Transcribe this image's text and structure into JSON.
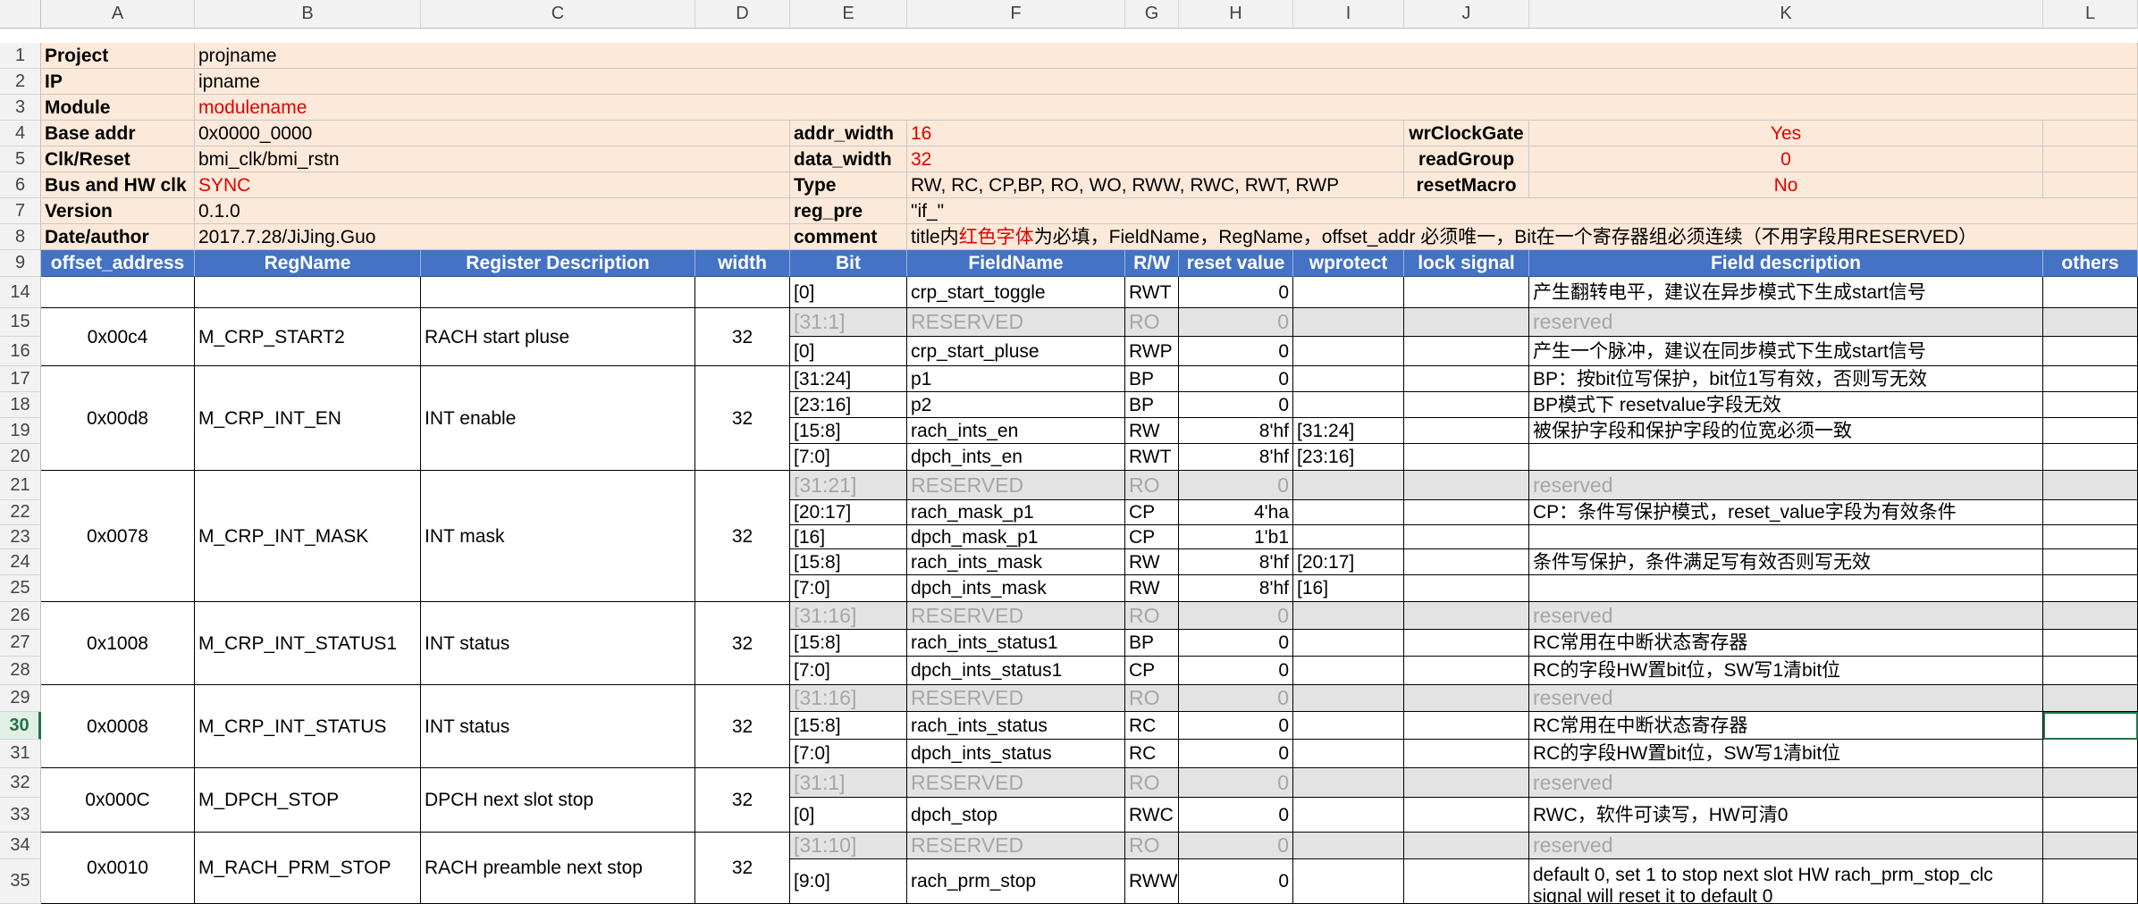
{
  "columns": [
    "A",
    "B",
    "C",
    "D",
    "E",
    "F",
    "G",
    "H",
    "I",
    "J",
    "K",
    "L"
  ],
  "meta": {
    "project_label": "Project",
    "project_value": "projname",
    "ip_label": "IP",
    "ip_value": "ipname",
    "module_label": "Module",
    "module_value": "modulename",
    "base_addr_label": "Base addr",
    "base_addr_value": "0x0000_0000",
    "clk_label": "Clk/Reset",
    "clk_value": "bmi_clk/bmi_rstn",
    "bus_label": "Bus and HW clk",
    "bus_value": "SYNC",
    "version_label": "Version",
    "version_value": "0.1.0",
    "date_label": "Date/author",
    "date_value": "2017.7.28/JiJing.Guo",
    "addr_width_label": "addr_width",
    "addr_width_value": "16",
    "data_width_label": "data_width",
    "data_width_value": "32",
    "type_label": "Type",
    "type_value": "RW, RC, CP,BP, RO, WO, RWW, RWC, RWT, RWP",
    "reg_pre_label": "reg_pre",
    "reg_pre_value": "\"if_\"",
    "comment_label": "comment",
    "comment_prefix": "title内",
    "comment_red": "红色字体",
    "comment_suffix": "为必填，FieldName，RegName，offset_addr 必须唯一，Bit在一个寄存器组必须连续（不用字段用RESERVED）",
    "wrclockgate_label": "wrClockGate",
    "wrclockgate_value": "Yes",
    "readgroup_label": "readGroup",
    "readgroup_value": "0",
    "resetmacro_label": "resetMacro",
    "resetmacro_value": "No"
  },
  "headers": {
    "offset": "offset_address",
    "regname": "RegName",
    "regdesc": "Register Description",
    "width": "width",
    "bit": "Bit",
    "fieldname": "FieldName",
    "rw": "R/W",
    "reset": "reset value",
    "wprotect": "wprotect",
    "lock": "lock signal",
    "fielddesc": "Field description",
    "others": "others"
  },
  "registers": [
    {
      "offset": "",
      "name": "",
      "desc": "",
      "width": ""
    },
    {
      "offset": "0x00c4",
      "name": "M_CRP_START2",
      "desc": "RACH start pluse",
      "width": "32"
    },
    {
      "offset": "0x00d8",
      "name": "M_CRP_INT_EN",
      "desc": "INT enable",
      "width": "32"
    },
    {
      "offset": "0x0078",
      "name": "M_CRP_INT_MASK",
      "desc": "INT mask",
      "width": "32"
    },
    {
      "offset": "0x1008",
      "name": "M_CRP_INT_STATUS1",
      "desc": "INT status",
      "width": "32"
    },
    {
      "offset": "0x0008",
      "name": "M_CRP_INT_STATUS",
      "desc": "INT status",
      "width": "32"
    },
    {
      "offset": "0x000C",
      "name": "M_DPCH_STOP",
      "desc": "DPCH next slot stop",
      "width": "32"
    },
    {
      "offset": "0x0010",
      "name": "M_RACH_PRM_STOP",
      "desc": "RACH preamble next stop",
      "width": "32"
    }
  ],
  "fields": [
    {
      "row": "14",
      "bit": "[0]",
      "name": "crp_start_toggle",
      "rw": "RWT",
      "reset": "0",
      "wprotect": "",
      "desc": "产生翻转电平，建议在异步模式下生成start信号"
    },
    {
      "row": "15",
      "bit": "[31:1]",
      "name": "RESERVED",
      "rw": "RO",
      "reset": "0",
      "wprotect": "",
      "desc": "reserved"
    },
    {
      "row": "16",
      "bit": "[0]",
      "name": "crp_start_pluse",
      "rw": "RWP",
      "reset": "0",
      "wprotect": "",
      "desc": "产生一个脉冲，建议在同步模式下生成start信号"
    },
    {
      "row": "17",
      "bit": "[31:24]",
      "name": "p1",
      "rw": "BP",
      "reset": "0",
      "wprotect": "",
      "desc": "BP：按bit位写保护，bit位1写有效，否则写无效"
    },
    {
      "row": "18",
      "bit": "[23:16]",
      "name": "p2",
      "rw": "BP",
      "reset": "0",
      "wprotect": "",
      "desc": "BP模式下 resetvalue字段无效"
    },
    {
      "row": "19",
      "bit": "[15:8]",
      "name": "rach_ints_en",
      "rw": "RW",
      "reset": "8'hf",
      "wprotect": "[31:24]",
      "desc": "被保护字段和保护字段的位宽必须一致"
    },
    {
      "row": "20",
      "bit": "[7:0]",
      "name": "dpch_ints_en",
      "rw": "RWT",
      "reset": "8'hf",
      "wprotect": "[23:16]",
      "desc": ""
    },
    {
      "row": "21",
      "bit": "[31:21]",
      "name": "RESERVED",
      "rw": "RO",
      "reset": "0",
      "wprotect": "",
      "desc": "reserved"
    },
    {
      "row": "22",
      "bit": "[20:17]",
      "name": "rach_mask_p1",
      "rw": "CP",
      "reset": "4'ha",
      "wprotect": "",
      "desc": "CP：条件写保护模式，reset_value字段为有效条件"
    },
    {
      "row": "23",
      "bit": "[16]",
      "name": "dpch_mask_p1",
      "rw": "CP",
      "reset": "1'b1",
      "wprotect": "",
      "desc": ""
    },
    {
      "row": "24",
      "bit": "[15:8]",
      "name": "rach_ints_mask",
      "rw": "RW",
      "reset": "8'hf",
      "wprotect": "[20:17]",
      "desc": "条件写保护，条件满足写有效否则写无效"
    },
    {
      "row": "25",
      "bit": "[7:0]",
      "name": "dpch_ints_mask",
      "rw": "RW",
      "reset": "8'hf",
      "wprotect": "[16]",
      "desc": ""
    },
    {
      "row": "26",
      "bit": "[31:16]",
      "name": "RESERVED",
      "rw": "RO",
      "reset": "0",
      "wprotect": "",
      "desc": "reserved"
    },
    {
      "row": "27",
      "bit": "[15:8]",
      "name": "rach_ints_status1",
      "rw": "BP",
      "reset": "0",
      "wprotect": "",
      "desc": "RC常用在中断状态寄存器"
    },
    {
      "row": "28",
      "bit": "[7:0]",
      "name": "dpch_ints_status1",
      "rw": "CP",
      "reset": "0",
      "wprotect": "",
      "desc": "RC的字段HW置bit位，SW写1清bit位"
    },
    {
      "row": "29",
      "bit": "[31:16]",
      "name": "RESERVED",
      "rw": "RO",
      "reset": "0",
      "wprotect": "",
      "desc": "reserved"
    },
    {
      "row": "30",
      "bit": "[15:8]",
      "name": "rach_ints_status",
      "rw": "RC",
      "reset": "0",
      "wprotect": "",
      "desc": "RC常用在中断状态寄存器"
    },
    {
      "row": "31",
      "bit": "[7:0]",
      "name": "dpch_ints_status",
      "rw": "RC",
      "reset": "0",
      "wprotect": "",
      "desc": "RC的字段HW置bit位，SW写1清bit位"
    },
    {
      "row": "32",
      "bit": "[31:1]",
      "name": "RESERVED",
      "rw": "RO",
      "reset": "0",
      "wprotect": "",
      "desc": "reserved"
    },
    {
      "row": "33",
      "bit": "[0]",
      "name": "dpch_stop",
      "rw": "RWC",
      "reset": "0",
      "wprotect": "",
      "desc": "RWC，软件可读写，HW可清0"
    },
    {
      "row": "34",
      "bit": "[31:10]",
      "name": "RESERVED",
      "rw": "RO",
      "reset": "0",
      "wprotect": "",
      "desc": "reserved"
    },
    {
      "row": "35",
      "bit": "[9:0]",
      "name": "rach_prm_stop",
      "rw": "RWW",
      "reset": "0",
      "wprotect": "",
      "desc": "default 0, set 1 to stop next slot HW rach_prm_stop_clc signal will reset it to default 0"
    }
  ],
  "meta_row_numbers": [
    "1",
    "2",
    "3",
    "4",
    "5",
    "6",
    "7",
    "8",
    "9"
  ],
  "active_row": "30",
  "colors": {
    "header_blue": "#4472c4",
    "meta_peach": "#fde9d9",
    "required_red": "#e00000",
    "reserved_gray": "#e3e3e3",
    "excel_green": "#217346"
  }
}
